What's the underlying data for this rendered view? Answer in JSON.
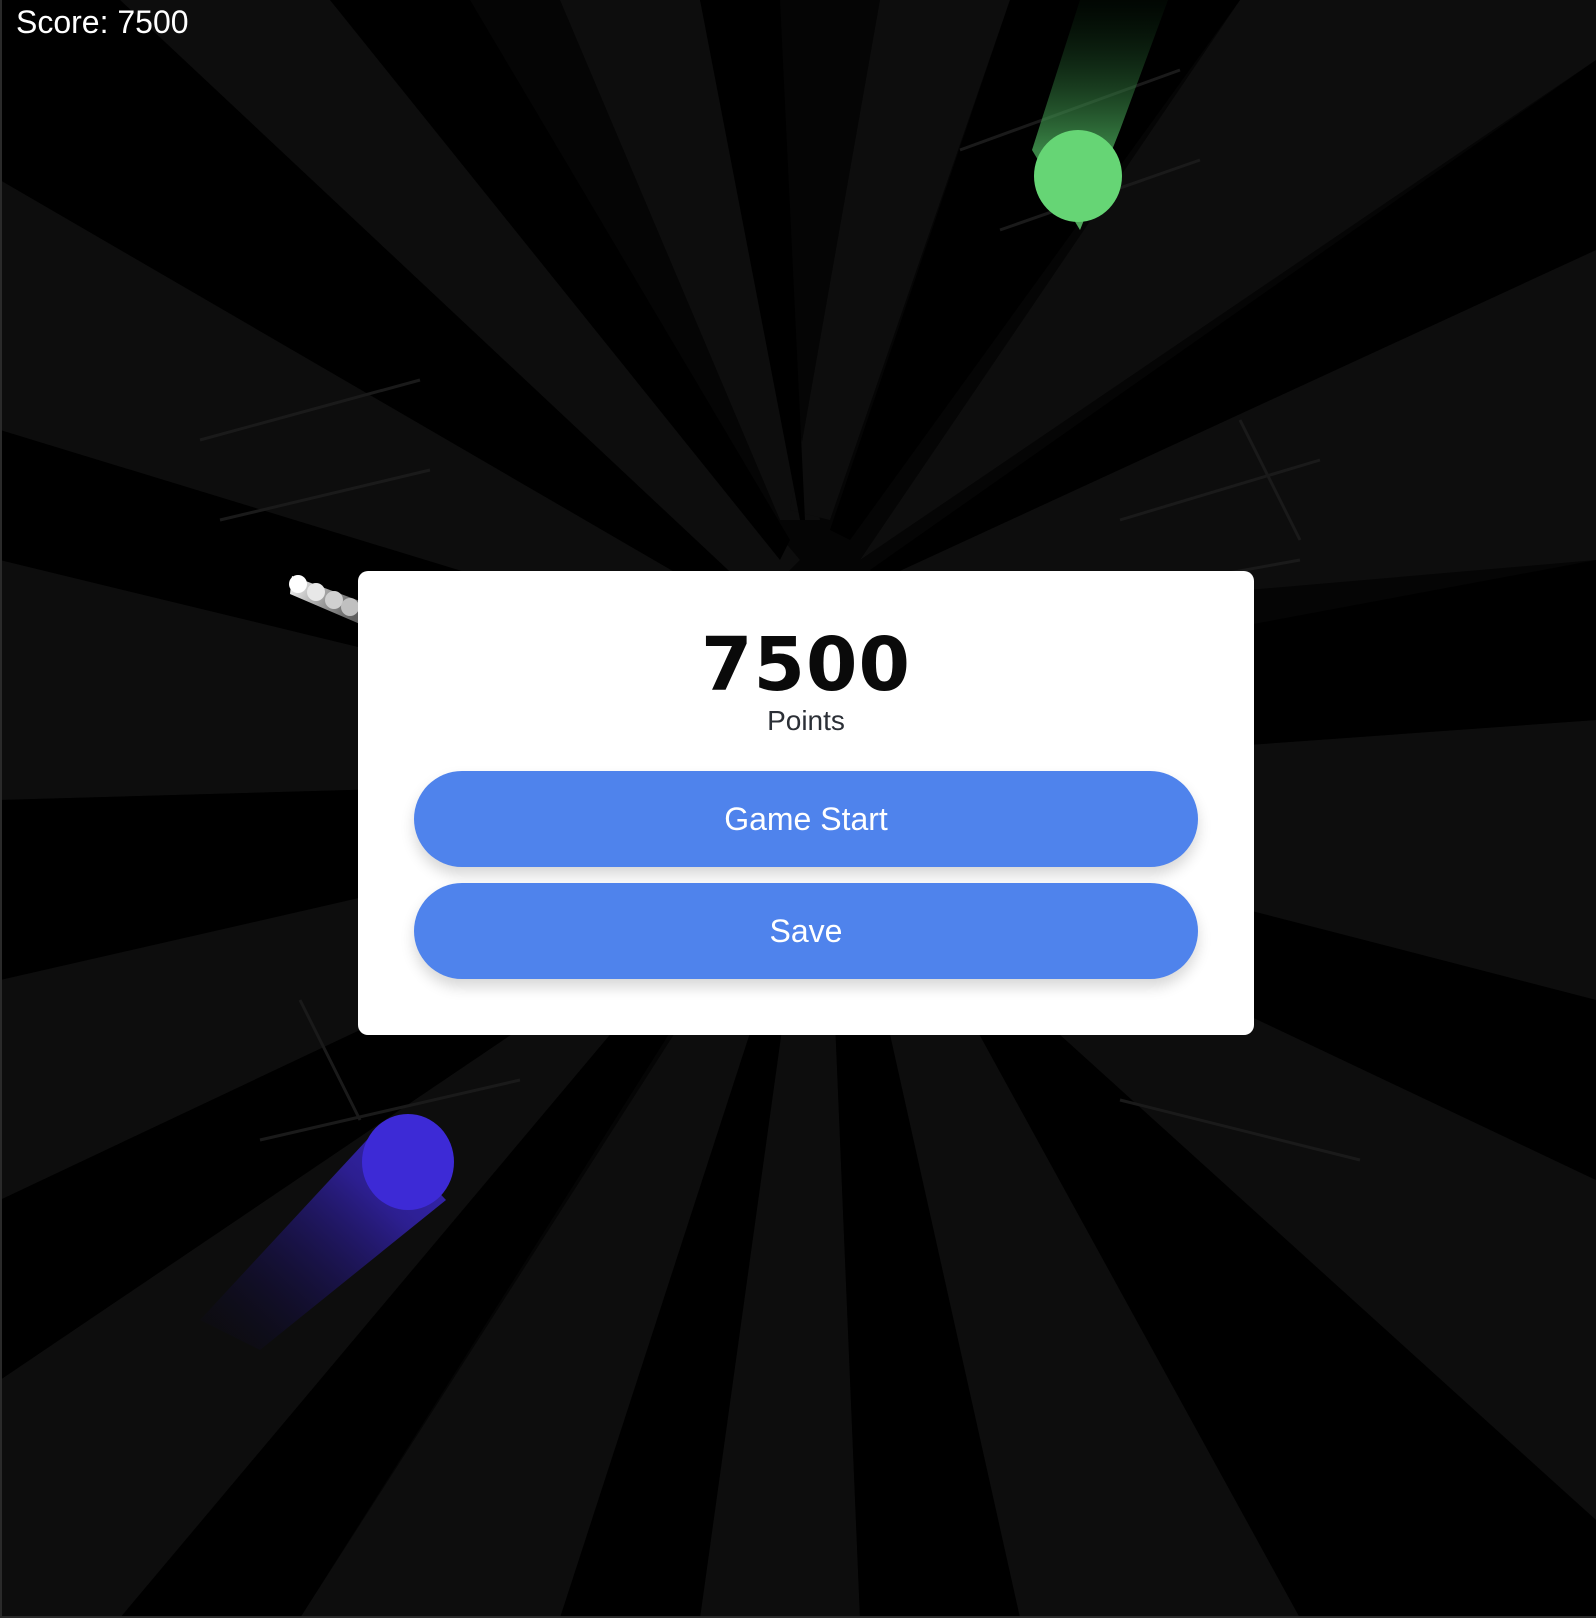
{
  "hud": {
    "score_label": "Score:",
    "score_value": "7500"
  },
  "modal": {
    "final_score": "7500",
    "points_label": "Points",
    "start_button_label": "Game Start",
    "save_button_label": "Save"
  },
  "colors": {
    "background": "#050505",
    "modal_background": "#ffffff",
    "button_blue": "#4f83ec",
    "green_projectile": "#66d575",
    "blue_projectile": "#3d2ad6",
    "white_projectile": "#ffffff"
  }
}
